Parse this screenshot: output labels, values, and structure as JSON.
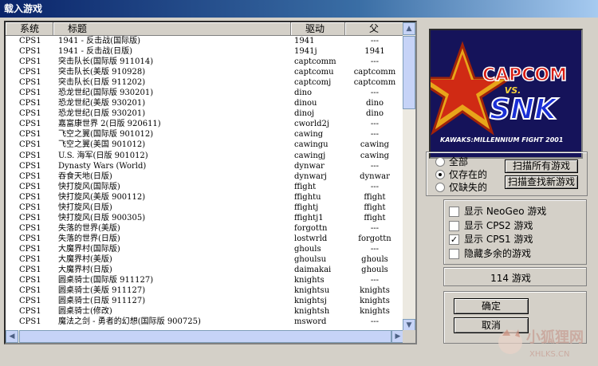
{
  "window": {
    "title": "载入游戏"
  },
  "list": {
    "columns": [
      "系统",
      "标题",
      "驱动",
      "父"
    ],
    "rows": [
      [
        "CPS1",
        "1941 - 反击战(国际版)",
        "1941",
        "---"
      ],
      [
        "CPS1",
        "1941 - 反击战(日版)",
        "1941j",
        "1941"
      ],
      [
        "CPS1",
        "突击队长(国际版 911014)",
        "captcomm",
        "---"
      ],
      [
        "CPS1",
        "突击队长(美版 910928)",
        "captcomu",
        "captcomm"
      ],
      [
        "CPS1",
        "突击队长(日版 911202)",
        "captcomj",
        "captcomm"
      ],
      [
        "CPS1",
        "恐龙世纪(国际版 930201)",
        "dino",
        "---"
      ],
      [
        "CPS1",
        "恐龙世纪(美版 930201)",
        "dinou",
        "dino"
      ],
      [
        "CPS1",
        "恐龙世纪(日版 930201)",
        "dinoj",
        "dino"
      ],
      [
        "CPS1",
        "嘉富康世界 2(日版 920611)",
        "cworld2j",
        "---"
      ],
      [
        "CPS1",
        "飞空之翼(国际版 901012)",
        "cawing",
        "---"
      ],
      [
        "CPS1",
        "飞空之翼(美国 901012)",
        "cawingu",
        "cawing"
      ],
      [
        "CPS1",
        "U.S. 海军(日版 901012)",
        "cawingj",
        "cawing"
      ],
      [
        "CPS1",
        "Dynasty Wars (World)",
        "dynwar",
        "---"
      ],
      [
        "CPS1",
        "吞食天地(日版)",
        "dynwarj",
        "dynwar"
      ],
      [
        "CPS1",
        "快打旋风(国际版)",
        "ffight",
        "---"
      ],
      [
        "CPS1",
        "快打旋风(美版 900112)",
        "ffightu",
        "ffight"
      ],
      [
        "CPS1",
        "快打旋风(日版)",
        "ffightj",
        "ffight"
      ],
      [
        "CPS1",
        "快打旋风(日版 900305)",
        "ffightj1",
        "ffight"
      ],
      [
        "CPS1",
        "失落的世界(美版)",
        "forgottn",
        "---"
      ],
      [
        "CPS1",
        "失落的世界(日版)",
        "lostwrld",
        "forgottn"
      ],
      [
        "CPS1",
        "大魔界村(国际版)",
        "ghouls",
        "---"
      ],
      [
        "CPS1",
        "大魔界村(美版)",
        "ghoulsu",
        "ghouls"
      ],
      [
        "CPS1",
        "大魔界村(日版)",
        "daimakai",
        "ghouls"
      ],
      [
        "CPS1",
        "圆桌骑士(国际版 911127)",
        "knights",
        "---"
      ],
      [
        "CPS1",
        "圆桌骑士(美版 911127)",
        "knightsu",
        "knights"
      ],
      [
        "CPS1",
        "圆桌骑士(日版 911127)",
        "knightsj",
        "knights"
      ],
      [
        "CPS1",
        "圆桌骑士(修改)",
        "knightsh",
        "knights"
      ],
      [
        "CPS1",
        "魔法之剑 - 勇者的幻想(国际版 900725)",
        "msword",
        "---"
      ]
    ]
  },
  "logo": {
    "line1": "CAPCOM",
    "vs": "VS.",
    "line2": "SNK",
    "subtitle": "MILLENNIUM FIGHT 2001",
    "prefix": "KAWAKS:"
  },
  "filter": {
    "options": [
      "全部",
      "仅存在的",
      "仅缺失的"
    ],
    "selected": 1,
    "scan_all_label": "扫描所有游戏",
    "scan_new_label": "扫描查找新游戏"
  },
  "display": {
    "options": [
      {
        "label": "显示 NeoGeo 游戏",
        "checked": false
      },
      {
        "label": "显示 CPS2 游戏",
        "checked": false
      },
      {
        "label": "显示 CPS1 游戏",
        "checked": true
      },
      {
        "label": "隐藏多余的游戏",
        "checked": false
      }
    ]
  },
  "count_text": "114 游戏",
  "buttons": {
    "ok": "确定",
    "cancel": "取消"
  },
  "watermark": {
    "text": "小狐狸网",
    "url": "XHLKS.CN"
  }
}
